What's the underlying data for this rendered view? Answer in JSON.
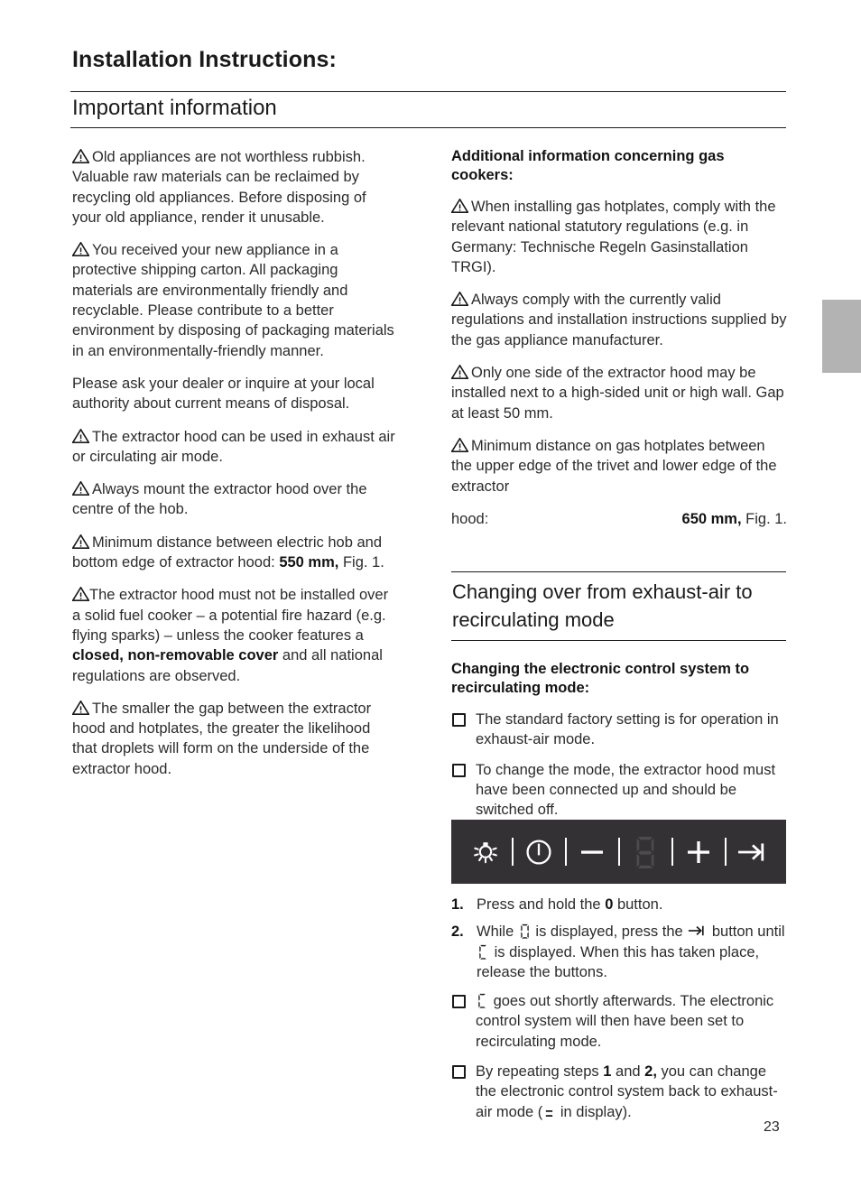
{
  "document": {
    "title": "Installation Instructions:",
    "page_number": "23"
  },
  "left_column": {
    "heading": "Important information",
    "paragraphs": [
      {
        "icon": "warning-triangle-icon",
        "text": "Old appliances are not worthless rubbish. Valuable raw materials can be reclaimed by recycling old appliances. Before disposing of your old appliance, render it unusable."
      },
      {
        "icon": "warning-triangle-icon",
        "text": "You received your new appliance in a protective shipping carton. All packaging materials are environmentally friendly and recyclable. Please contribute to a better environment by disposing of packaging materials in an environmentally-friendly manner."
      },
      {
        "icon": null,
        "text": "Please ask your dealer or inquire at your local authority about current means of disposal."
      },
      {
        "icon": "warning-triangle-icon",
        "text": "The extractor hood can be used in exhaust air or circulating air mode."
      },
      {
        "icon": "warning-triangle-icon",
        "text": "Always mount the extractor hood over the centre of the hob."
      }
    ],
    "min_distance_electric": {
      "icon": "warning-triangle-icon",
      "lead": "Minimum distance between electric hob and bottom edge of extractor hood: ",
      "bold": "550 mm,",
      "tail": " Fig. 1."
    },
    "solid_fuel_warning": {
      "icon": "warning-triangle-icon",
      "part1": "The extractor hood must not be installed over a solid fuel cooker – a potential fire hazard (e.g. flying sparks) – unless the cooker features a ",
      "bold": "closed, non-removable cover",
      "part2": " and all national regulations are observed."
    },
    "droplets_warning": {
      "icon": "warning-triangle-icon",
      "text": "The smaller the gap between the extractor hood and hotplates, the greater the likelihood that droplets will form on the underside of the extractor hood."
    }
  },
  "right_column": {
    "gas_subheading": "Additional information concerning gas cookers:",
    "gas_paragraphs": [
      {
        "icon": "warning-triangle-icon",
        "text": "When installing gas hotplates, comply with the relevant national statutory regulations (e.g. in Germany: Technische Regeln Gasinstallation TRGI)."
      },
      {
        "icon": "warning-triangle-icon",
        "text": "Always comply with the currently valid regulations and installation instructions supplied by the gas appliance manufacturer."
      },
      {
        "icon": "warning-triangle-icon",
        "text": "Only one side of the extractor hood may be installed next to a high-sided unit or high wall. Gap at least 50 mm."
      }
    ],
    "min_distance_gas": {
      "icon": "warning-triangle-icon",
      "lead": "Minimum distance on gas hotplates between the upper edge of the trivet and lower edge of the extractor",
      "label": "hood:",
      "bold": "650 mm,",
      "tail": " Fig. 1."
    },
    "section_heading": "Changing over from exhaust-air to recirculating mode",
    "mode_subheading": "Changing the electronic control system to recirculating mode:",
    "mode_bullets": [
      "The standard factory setting is for operation in exhaust-air mode.",
      "To change the mode, the extractor hood must have been connected up and should be switched off."
    ],
    "control_panel": {
      "items": [
        "light-bulb-icon",
        "separator",
        "power-icon",
        "separator",
        "minus-icon",
        "separator",
        "seven-segment-display-icon",
        "separator",
        "plus-icon",
        "separator",
        "arrow-to-bar-icon"
      ]
    },
    "steps": [
      {
        "number": "1.",
        "part1": "Press and hold the ",
        "bold": "0",
        "part2": " button."
      },
      {
        "number": "2.",
        "part1": "While ",
        "glyph1": "seven-segment-0-glyph",
        "part2": " is displayed, press the ",
        "glyph2": "arrow-to-bar-glyph",
        "part3": " button until ",
        "glyph3": "seven-segment-C-glyph",
        "part4": " is displayed. When this has taken place, release the buttons."
      }
    ],
    "result_bullets": [
      {
        "glyph": "seven-segment-C-glyph",
        "text": " goes out shortly afterwards. The electronic control system will then have been set to recirculating mode."
      },
      {
        "part1": "By repeating steps ",
        "bold1": "1",
        "part2": " and ",
        "bold2": "2,",
        "part3": " you can change the electronic control system back to exhaust-air mode (",
        "glyph": "two-bar-glyph",
        "part4": " in display)."
      }
    ]
  },
  "colors": {
    "text": "#2b2b2b",
    "rule": "#1a1a1a",
    "panel_background": "#333133",
    "panel_foreground": "#ffffff",
    "panel_display_dim": "#4d4b4d",
    "edge_tab": "#b3b3b3"
  }
}
